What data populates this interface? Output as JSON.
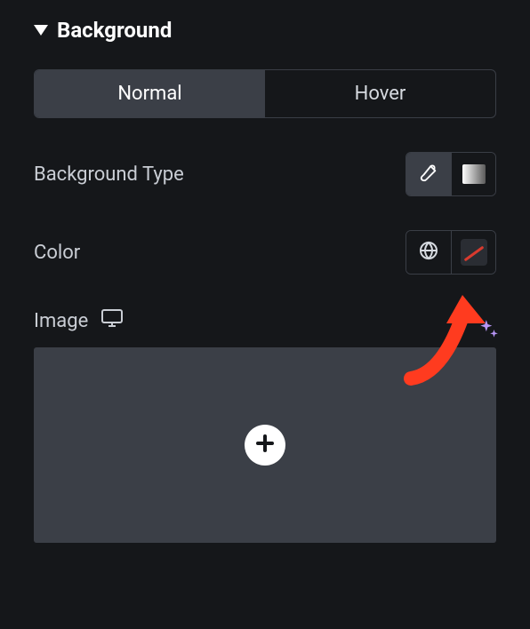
{
  "section": {
    "title": "Background"
  },
  "tabs": {
    "normal": "Normal",
    "hover": "Hover"
  },
  "labels": {
    "backgroundType": "Background Type",
    "color": "Color",
    "image": "Image"
  }
}
